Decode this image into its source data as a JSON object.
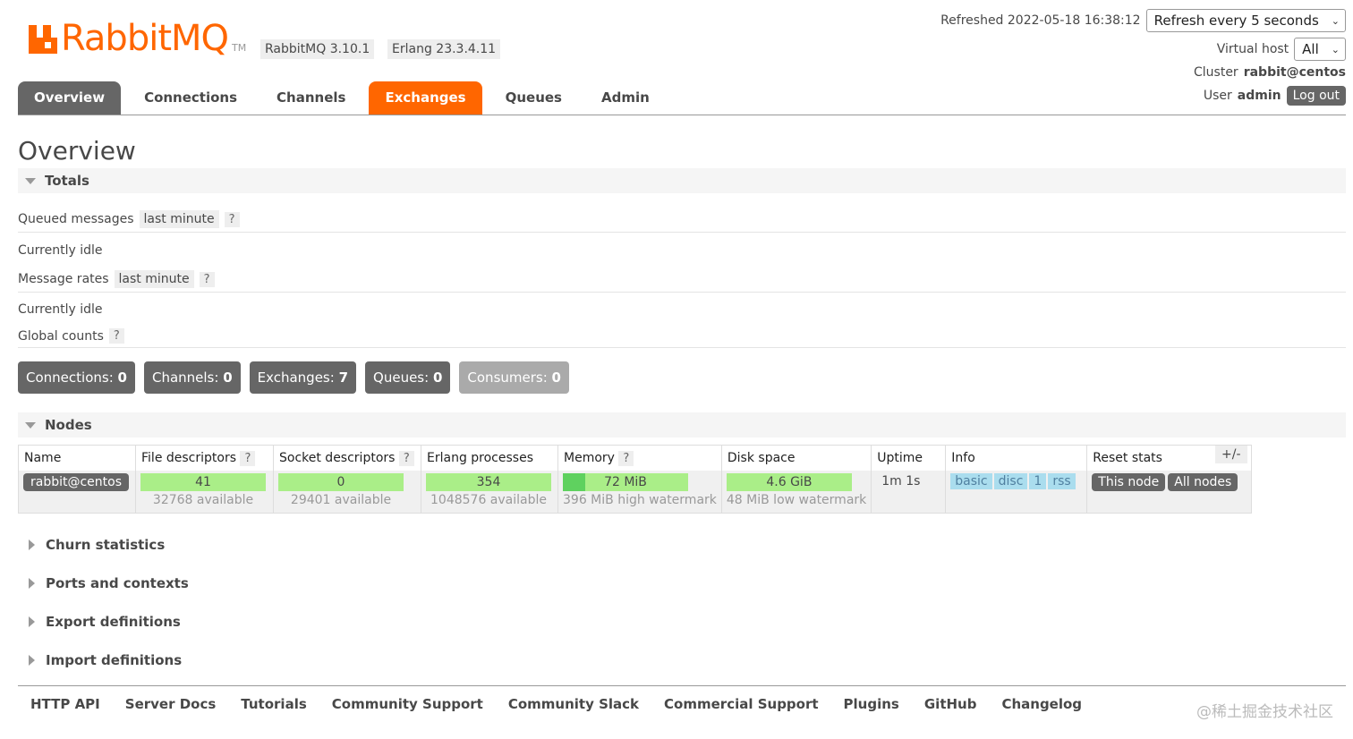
{
  "brand": {
    "name": "RabbitMQ",
    "tm": "TM"
  },
  "versions": {
    "rabbitmq": "RabbitMQ 3.10.1",
    "erlang": "Erlang 23.3.4.11"
  },
  "header": {
    "refreshed_label": "Refreshed 2022-05-18 16:38:12",
    "refresh_select": "Refresh every 5 seconds",
    "vhost_label": "Virtual host",
    "vhost_select": "All",
    "cluster_label": "Cluster",
    "cluster_value": "rabbit@centos",
    "user_label": "User",
    "user_value": "admin",
    "logout": "Log out"
  },
  "tabs": [
    {
      "label": "Overview"
    },
    {
      "label": "Connections"
    },
    {
      "label": "Channels"
    },
    {
      "label": "Exchanges"
    },
    {
      "label": "Queues"
    },
    {
      "label": "Admin"
    }
  ],
  "page_title": "Overview",
  "totals": {
    "header": "Totals",
    "queued_label": "Queued messages",
    "queued_range": "last minute",
    "help": "?",
    "idle1": "Currently idle",
    "rates_label": "Message rates",
    "rates_range": "last minute",
    "idle2": "Currently idle",
    "global_label": "Global counts",
    "counts": [
      {
        "label": "Connections:",
        "value": "0"
      },
      {
        "label": "Channels:",
        "value": "0"
      },
      {
        "label": "Exchanges:",
        "value": "7"
      },
      {
        "label": "Queues:",
        "value": "0"
      },
      {
        "label": "Consumers:",
        "value": "0"
      }
    ]
  },
  "nodes": {
    "header": "Nodes",
    "columns": [
      "Name",
      "File descriptors",
      "Socket descriptors",
      "Erlang processes",
      "Memory",
      "Disk space",
      "Uptime",
      "Info",
      "Reset stats"
    ],
    "toggle": "+/-",
    "row": {
      "name": "rabbit@centos",
      "fd_value": "41",
      "fd_sub": "32768 available",
      "sock_value": "0",
      "sock_sub": "29401 available",
      "proc_value": "354",
      "proc_sub": "1048576 available",
      "mem_value": "72 MiB",
      "mem_sub": "396 MiB high watermark",
      "mem_fraction": 0.18,
      "disk_value": "4.6 GiB",
      "disk_sub": "48 MiB low watermark",
      "uptime": "1m 1s",
      "info": [
        "basic",
        "disc",
        "1",
        "rss"
      ],
      "reset_this": "This node",
      "reset_all": "All nodes"
    }
  },
  "sections": [
    "Churn statistics",
    "Ports and contexts",
    "Export definitions",
    "Import definitions"
  ],
  "footer": [
    "HTTP API",
    "Server Docs",
    "Tutorials",
    "Community Support",
    "Community Slack",
    "Commercial Support",
    "Plugins",
    "GitHub",
    "Changelog"
  ],
  "watermark": "@稀土掘金技术社区",
  "colors": {
    "brand": "#ff6600",
    "tab_active": "#666666",
    "bar_ok": "#aaee88"
  }
}
